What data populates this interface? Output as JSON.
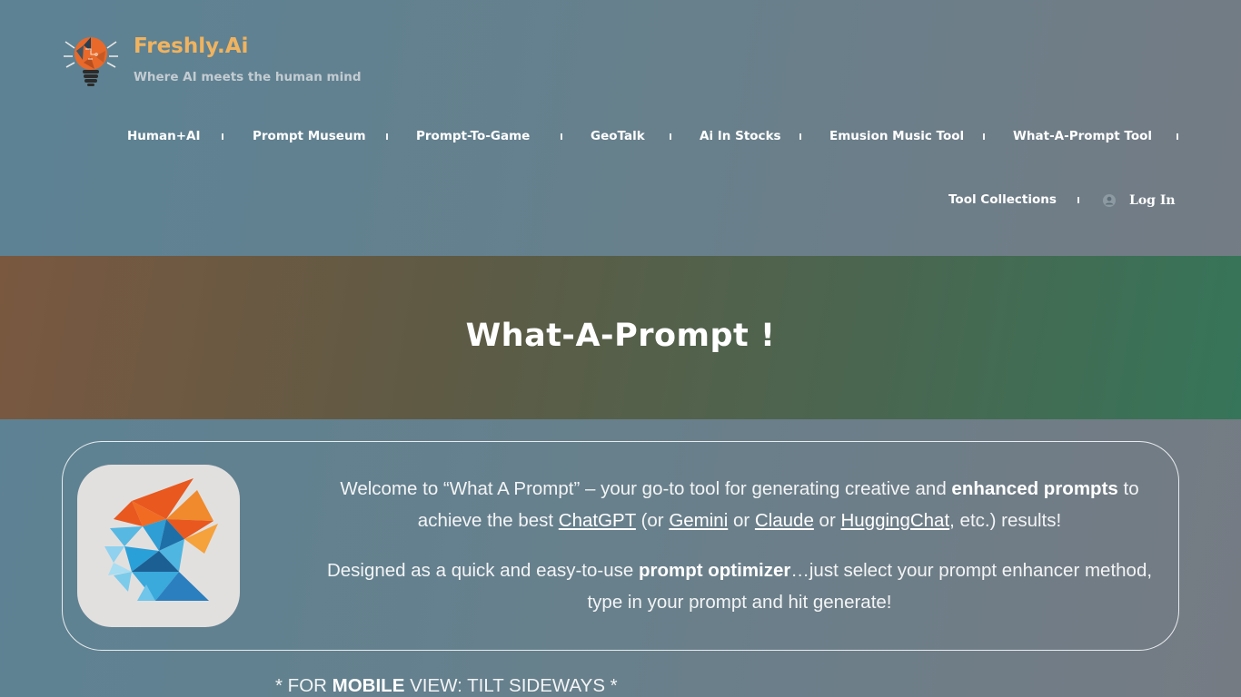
{
  "brand": {
    "name": "Freshly.Ai",
    "tagline": "Where AI meets the human mind",
    "logo_icon": "lightbulb-brain-icon"
  },
  "nav": {
    "items": [
      {
        "label": "Human+AI"
      },
      {
        "label": "Prompt Museum"
      },
      {
        "label": "Prompt-To-Game"
      },
      {
        "label": "GeoTalk"
      },
      {
        "label": "Ai In Stocks"
      },
      {
        "label": "Emusion Music Tool"
      },
      {
        "label": "What-A-Prompt Tool"
      },
      {
        "label": "Tool Collections"
      }
    ],
    "login_label": "Log In",
    "login_icon": "user-circle-icon"
  },
  "hero": {
    "title": "What-A-Prompt !"
  },
  "intro": {
    "p1_a": "Welcome to “What A Prompt” – your go-to tool for generating creative and ",
    "p1_b": "enhanced prompts",
    "p1_c": " to achieve the best ",
    "link_chatgpt": "ChatGPT",
    "p1_d": " (or ",
    "link_gemini": "Gemini",
    "p1_e": " or ",
    "link_claude": "Claude",
    "p1_f": " or ",
    "link_huggingchat": "HuggingChat",
    "p1_g": ", etc.) results!",
    "p2_a": "Designed as a quick and easy-to-use ",
    "p2_b": "prompt optimizer",
    "p2_c": "…just select your prompt enhancer method, type in your prompt and hit generate!",
    "app_icon": "polygon-head-icon"
  },
  "mobile_note": {
    "a": "* FOR ",
    "b": "MOBILE",
    "c": " VIEW: TILT SIDEWAYS *"
  },
  "colors": {
    "brand_accent": "#f0b35f",
    "hero_start": "#7a5840",
    "hero_end": "#367559"
  }
}
